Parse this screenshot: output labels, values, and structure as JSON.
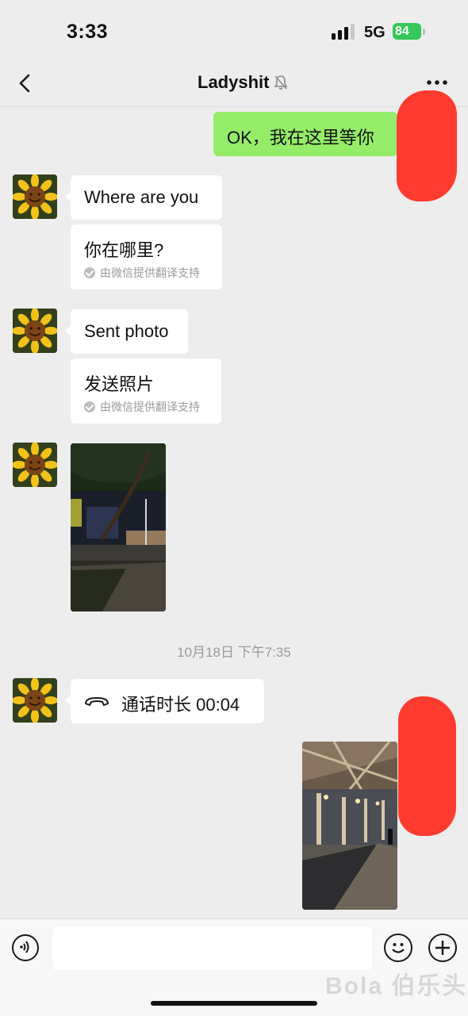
{
  "status_bar": {
    "time": "3:33",
    "network": "5G",
    "battery": "84"
  },
  "header": {
    "title": "Ladyshit"
  },
  "messages": {
    "m1": {
      "text": "OK，我在这里等你"
    },
    "m2": {
      "text": "Where are you",
      "translation": "你在哪里?",
      "translation_note": "由微信提供翻译支持"
    },
    "m3": {
      "text": "Sent photo",
      "translation": "发送照片",
      "translation_note": "由微信提供翻译支持"
    },
    "timestamp": "10月18日 下午7:35",
    "call": {
      "text": "通话时长 00:04"
    }
  },
  "input_bar": {
    "placeholder": ""
  },
  "watermark": "Bola 伯乐头条",
  "colors": {
    "self_bubble": "#95ec69",
    "background": "#ededed",
    "redaction": "#ff3b30",
    "battery": "#34c759"
  }
}
